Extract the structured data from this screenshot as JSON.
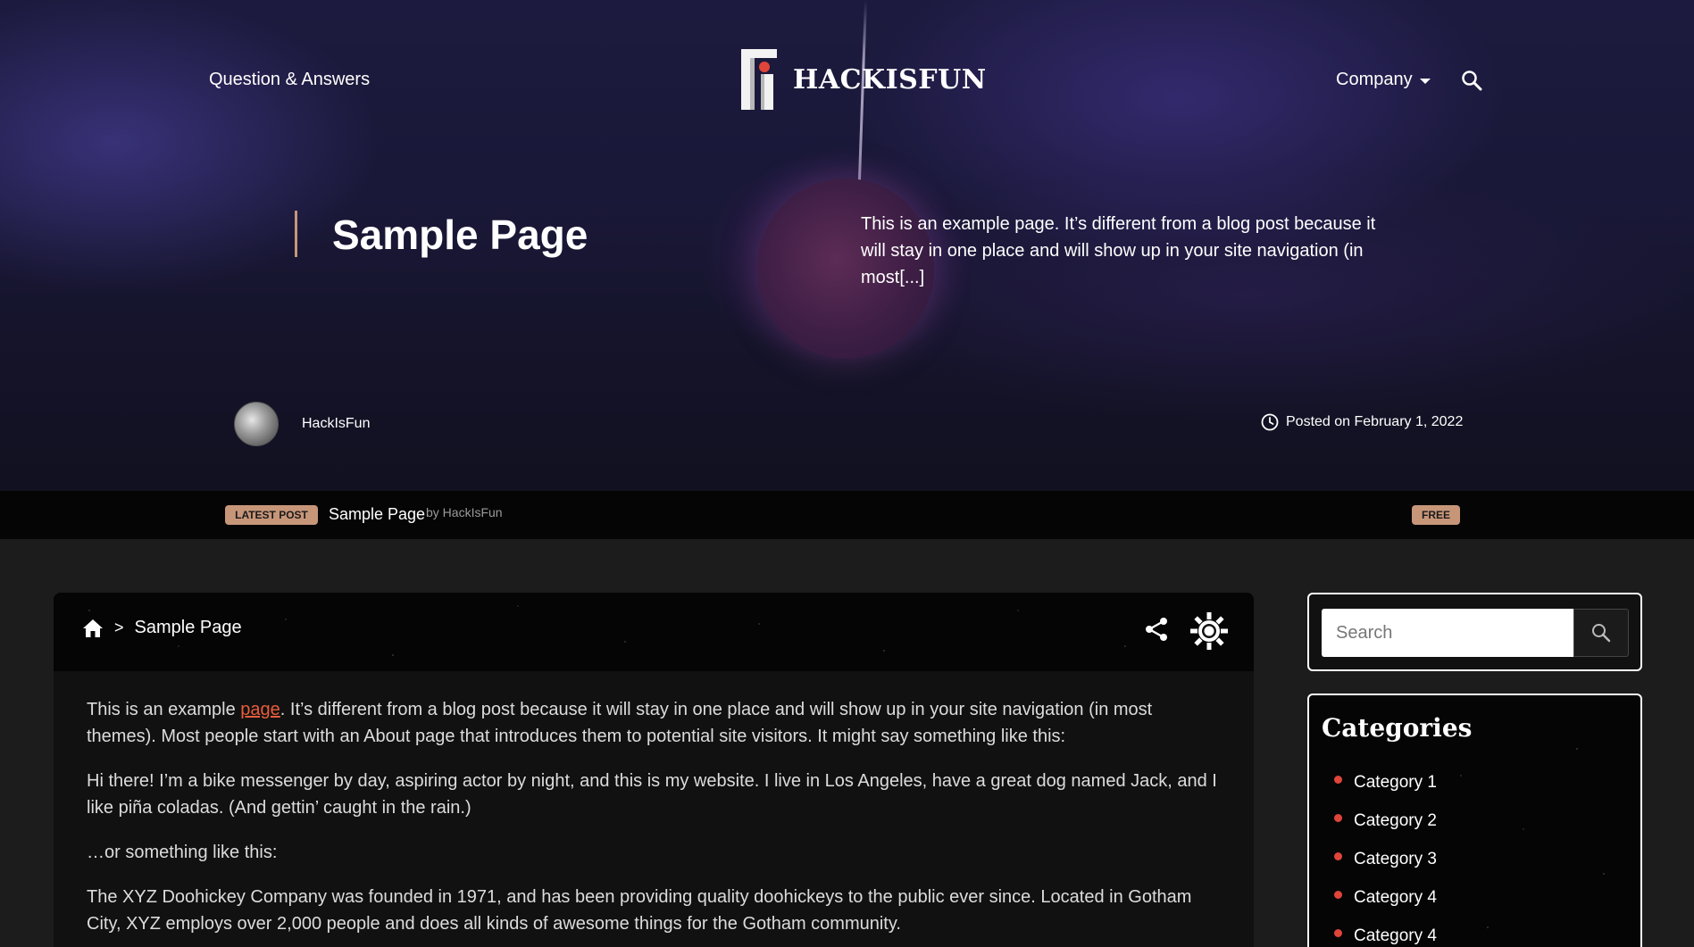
{
  "nav": {
    "left_link": "Question & Answers",
    "logo_text": "HACKISFUN",
    "company_label": "Company",
    "search_icon": "search-icon"
  },
  "hero": {
    "title": "Sample Page",
    "excerpt": "This is an example page. It’s different from a blog post because it will stay in one place and will show up in your site navigation (in most[...]",
    "author": "HackIsFun",
    "posted": "Posted on February 1, 2022"
  },
  "ticker": {
    "badge": "LATEST POST",
    "title": "Sample Page",
    "by": "by HackIsFun",
    "free_badge": "FREE"
  },
  "breadcrumb": {
    "home_icon": "home-icon",
    "separator": ">",
    "current": "Sample Page"
  },
  "article": {
    "p1_before": "This is an example ",
    "p1_link": "page",
    "p1_after": ". It’s different from a blog post because it will stay in one place and will show up in your site navigation (in most themes). Most people start with an About page that introduces them to potential site visitors. It might say something like this:",
    "p2": "Hi there! I’m a bike messenger by day, aspiring actor by night, and this is my website. I live in Los Angeles, have a great dog named Jack, and I like piña coladas. (And gettin’ caught in the rain.)",
    "p3": "…or something like this:",
    "p4": "The XYZ Doohickey Company was founded in 1971, and has been providing quality doohickeys to the public ever since. Located in Gotham City, XYZ employs over 2,000 people and does all kinds of awesome things for the Gotham community."
  },
  "sidebar": {
    "search_placeholder": "Search",
    "categories_title": "Categories",
    "categories": [
      {
        "label": "Category 1"
      },
      {
        "label": "Category 2"
      },
      {
        "label": "Category 3"
      },
      {
        "label": "Category 4"
      },
      {
        "label": "Category 4"
      }
    ]
  },
  "colors": {
    "accent": "#c79679",
    "link": "#e85d3c",
    "bullet": "#e0453a"
  }
}
